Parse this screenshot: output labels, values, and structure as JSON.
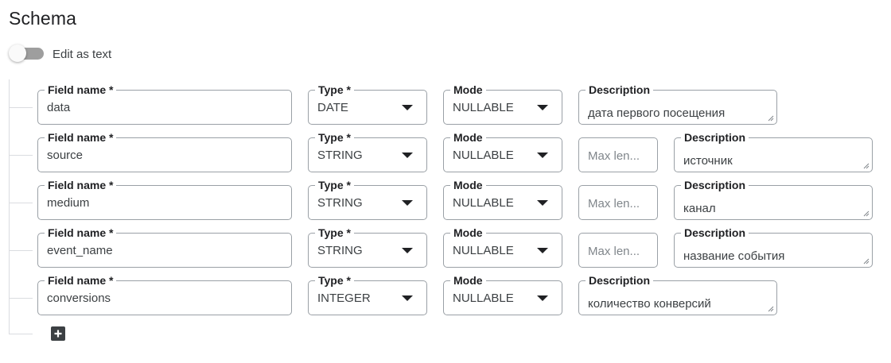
{
  "title": "Schema",
  "toggle": {
    "label": "Edit as text",
    "on": false
  },
  "labels": {
    "field_name": "Field name *",
    "type": "Type *",
    "mode": "Mode",
    "description": "Description"
  },
  "rows": [
    {
      "name": "data",
      "type": "DATE",
      "mode": "NULLABLE",
      "max_length_placeholder": null,
      "description": "дата первого посещения"
    },
    {
      "name": "source",
      "type": "STRING",
      "mode": "NULLABLE",
      "max_length_placeholder": "Max len...",
      "description": "источник"
    },
    {
      "name": "medium",
      "type": "STRING",
      "mode": "NULLABLE",
      "max_length_placeholder": "Max len...",
      "description": "канал"
    },
    {
      "name": "event_name",
      "type": "STRING",
      "mode": "NULLABLE",
      "max_length_placeholder": "Max len...",
      "description": "название события"
    },
    {
      "name": "conversions",
      "type": "INTEGER",
      "mode": "NULLABLE",
      "max_length_placeholder": null,
      "description": "количество конверсий"
    }
  ],
  "add_button": {
    "icon": "plus-box-icon"
  }
}
